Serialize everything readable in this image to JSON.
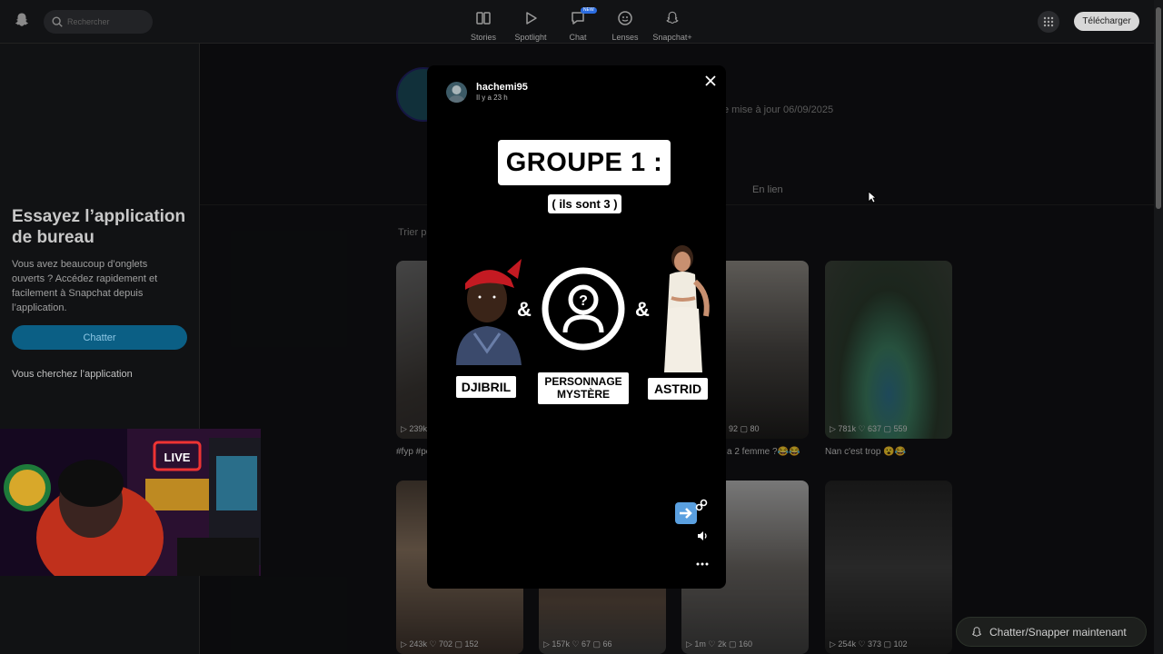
{
  "header": {
    "search_placeholder": "Rechercher",
    "nav": [
      {
        "label": "Stories",
        "icon": "stories-icon"
      },
      {
        "label": "Spotlight",
        "icon": "spotlight-play-icon"
      },
      {
        "label": "Chat",
        "icon": "chat-icon",
        "badge": "NEW"
      },
      {
        "label": "Lenses",
        "icon": "lenses-icon"
      },
      {
        "label": "Snapchat+",
        "icon": "snapchat-plus-icon"
      }
    ],
    "download_label": "Télécharger"
  },
  "sidebar": {
    "promo_title": "Essayez l’application de bureau",
    "promo_text": "Vous avez beaucoup d’onglets ouverts ? Accédez rapidement et facilement à Snapchat depuis l’application.",
    "chat_button": "Chatter",
    "looking_text": "Vous cherchez l’application"
  },
  "profile": {
    "updated": "e mise à jour 06/09/2025",
    "tab_link": "En lien",
    "sort_label": "Trier p"
  },
  "tiles": [
    {
      "stats": "▷ 239k",
      "caption": "#fyp #pc"
    },
    {
      "stats": "92  ▢ 80",
      "caption": "a 2 femme ?😂😂"
    },
    {
      "stats": "▷ 781k  ♡ 637  ▢ 559",
      "caption": "Nan c'est trop 😮😂"
    },
    {
      "stats": "▷ 243k  ♡ 702  ▢ 152",
      "caption": ""
    },
    {
      "stats": "▷ 157k  ♡ 67  ▢ 66",
      "caption": ""
    },
    {
      "stats": "▷ 1m  ♡ 2k  ▢ 160",
      "caption": ""
    },
    {
      "stats": "▷ 254k  ♡ 373  ▢ 102",
      "caption": ""
    }
  ],
  "cta": {
    "label": "Chatter/Snapper maintenant"
  },
  "story": {
    "username": "hachemi95",
    "time": "Il y a 23 h",
    "group_title": "GROUPE 1 :",
    "group_sub": "( ils sont 3 )",
    "amp": "&",
    "names": [
      "DJIBRIL",
      "PERSONNAGE MYSTÈRE",
      "ASTRID"
    ]
  },
  "colors": {
    "accent_blue": "#0b5f85",
    "modal_bg": "#000000",
    "page_bg": "#111214"
  }
}
